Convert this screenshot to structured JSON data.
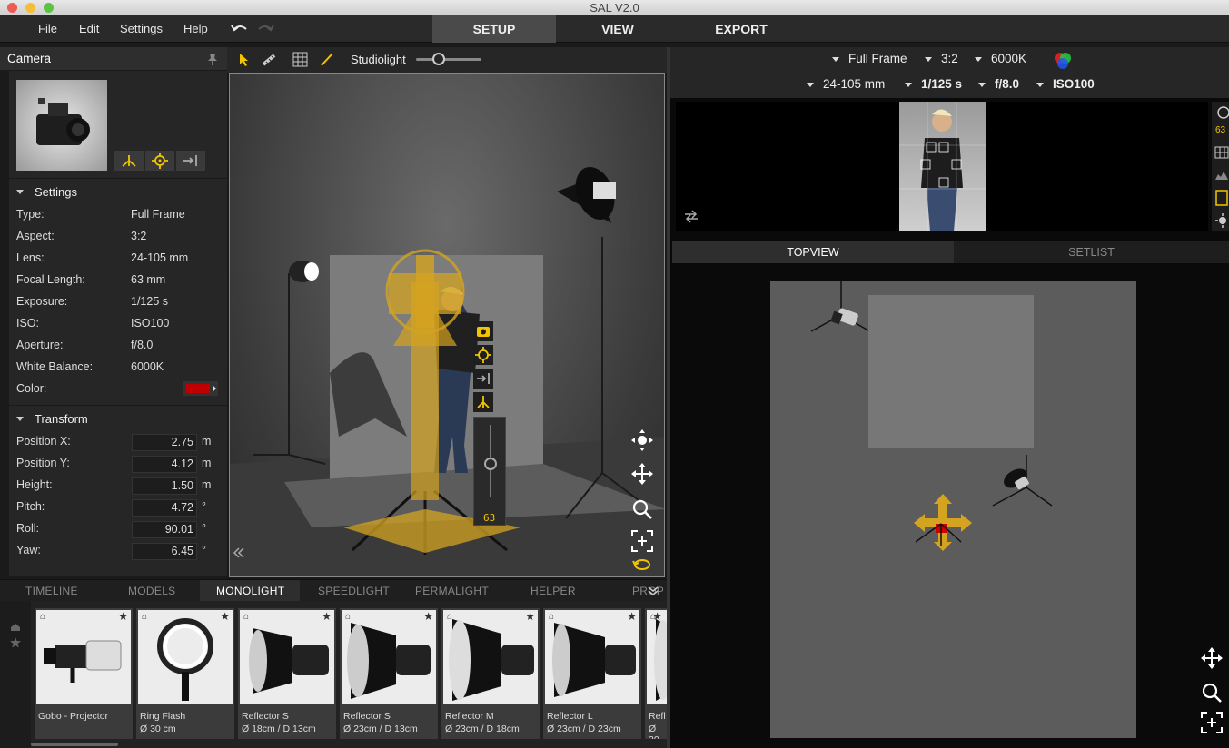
{
  "window": {
    "title": "SAL V2.0"
  },
  "menu": [
    "File",
    "Edit",
    "Settings",
    "Help"
  ],
  "main_tabs": [
    {
      "label": "SETUP",
      "active": true
    },
    {
      "label": "VIEW",
      "active": false
    },
    {
      "label": "EXPORT",
      "active": false
    }
  ],
  "camera_panel": {
    "title": "Camera",
    "settings_title": "Settings",
    "settings": [
      {
        "label": "Type:",
        "value": "Full Frame"
      },
      {
        "label": "Aspect:",
        "value": "3:2"
      },
      {
        "label": "Lens:",
        "value": "24-105 mm"
      },
      {
        "label": "Focal Length:",
        "value": "63 mm"
      },
      {
        "label": "Exposure:",
        "value": "1/125 s"
      },
      {
        "label": "ISO:",
        "value": "ISO100"
      },
      {
        "label": "Aperture:",
        "value": "f/8.0"
      },
      {
        "label": "White Balance:",
        "value": "6000K"
      },
      {
        "label": "Color:",
        "value": ""
      }
    ],
    "color_swatch": "#c00000",
    "transform_title": "Transform",
    "transform": [
      {
        "label": "Position X:",
        "value": "2.75",
        "unit": "m"
      },
      {
        "label": "Position Y:",
        "value": "4.12",
        "unit": "m"
      },
      {
        "label": "Height:",
        "value": "1.50",
        "unit": "m"
      },
      {
        "label": "Pitch:",
        "value": "4.72",
        "unit": "°"
      },
      {
        "label": "Roll:",
        "value": "90.01",
        "unit": "°"
      },
      {
        "label": "Yaw:",
        "value": "6.45",
        "unit": "°"
      }
    ]
  },
  "viewport_toolbar": {
    "light_label": "Studiolight",
    "light_level": 0.35
  },
  "viewport": {
    "focal_readout": "63"
  },
  "camera_bar": {
    "row1": [
      {
        "value": "Full Frame",
        "bold": false
      },
      {
        "value": "3:2",
        "bold": false
      },
      {
        "value": "6000K",
        "bold": false
      }
    ],
    "row2": [
      {
        "value": "24-105 mm",
        "bold": false
      },
      {
        "value": "1/125 s",
        "bold": true
      },
      {
        "value": "f/8.0",
        "bold": true
      },
      {
        "value": "ISO100",
        "bold": true
      }
    ],
    "side_readout": "63"
  },
  "view_tabs": [
    {
      "label": "TOPVIEW",
      "active": true
    },
    {
      "label": "SETLIST",
      "active": false
    }
  ],
  "bottom_tabs": [
    {
      "label": "TIMELINE",
      "active": false
    },
    {
      "label": "MODELS",
      "active": false
    },
    {
      "label": "MONOLIGHT",
      "active": true
    },
    {
      "label": "SPEEDLIGHT",
      "active": false
    },
    {
      "label": "PERMALIGHT",
      "active": false
    },
    {
      "label": "HELPER",
      "active": false
    },
    {
      "label": "PROPS",
      "active": false
    }
  ],
  "library": [
    {
      "name": "Gobo - Projector",
      "sub": ""
    },
    {
      "name": "Ring Flash",
      "sub": "Ø 30 cm"
    },
    {
      "name": "Reflector S",
      "sub": "Ø 18cm / D 13cm"
    },
    {
      "name": "Reflector S",
      "sub": "Ø 23cm / D 13cm"
    },
    {
      "name": "Reflector M",
      "sub": "Ø 23cm / D 18cm"
    },
    {
      "name": "Reflector L",
      "sub": "Ø 23cm / D 23cm"
    },
    {
      "name": "Refl",
      "sub": "Ø 30"
    }
  ],
  "accent_color": "#f2c500"
}
